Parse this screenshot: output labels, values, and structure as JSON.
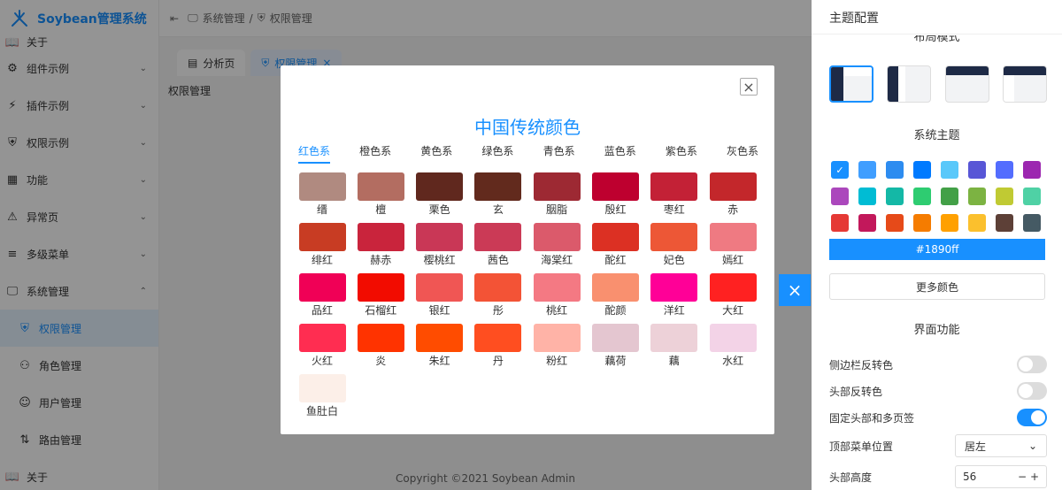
{
  "app": {
    "title": "Soybean管理系统"
  },
  "sidebar": {
    "items": [
      {
        "label": "关于",
        "icon": "book-icon",
        "clipped": true
      },
      {
        "label": "组件示例",
        "icon": "component-icon",
        "chevron": "⌄"
      },
      {
        "label": "插件示例",
        "icon": "plugin-icon",
        "chevron": "⌄"
      },
      {
        "label": "权限示例",
        "icon": "shield-icon",
        "chevron": "⌄"
      },
      {
        "label": "功能",
        "icon": "grid-icon",
        "chevron": "⌄"
      },
      {
        "label": "异常页",
        "icon": "error-page-icon",
        "chevron": "⌄"
      },
      {
        "label": "多级菜单",
        "icon": "menu-icon",
        "chevron": "⌄"
      },
      {
        "label": "系统管理",
        "icon": "monitor-icon",
        "chevron": "⌃"
      },
      {
        "label": "权限管理",
        "icon": "shield-icon",
        "active": true
      },
      {
        "label": "角色管理",
        "icon": "role-icon"
      },
      {
        "label": "用户管理",
        "icon": "user-icon"
      },
      {
        "label": "路由管理",
        "icon": "route-icon"
      },
      {
        "label": "关于",
        "icon": "book-icon"
      }
    ]
  },
  "header": {
    "breadcrumb": [
      "系统管理",
      "权限管理"
    ],
    "separator": "/"
  },
  "tabs": [
    {
      "label": "分析页",
      "icon": "dashboard-icon"
    },
    {
      "label": "权限管理",
      "icon": "shield-icon",
      "active": true,
      "close": "×"
    }
  ],
  "content": {
    "title": "权限管理"
  },
  "footer": {
    "text": "Copyright ©2021 Soybean Admin"
  },
  "modal": {
    "title": "中国传统颜色",
    "close": "×",
    "tabs": [
      "红色系",
      "橙色系",
      "黄色系",
      "绿色系",
      "青色系",
      "蓝色系",
      "紫色系",
      "灰色系"
    ],
    "active_tab": 0,
    "colors": [
      {
        "name": "缙",
        "color": "#b08a80"
      },
      {
        "name": "檀",
        "color": "#b36d61"
      },
      {
        "name": "栗色",
        "color": "#60281e"
      },
      {
        "name": "玄",
        "color": "#622a1d"
      },
      {
        "name": "胭脂",
        "color": "#9d2933"
      },
      {
        "name": "殷红",
        "color": "#be002f"
      },
      {
        "name": "枣红",
        "color": "#c32136"
      },
      {
        "name": "赤",
        "color": "#c3272b"
      },
      {
        "name": "绯红",
        "color": "#c83c23"
      },
      {
        "name": "赫赤",
        "color": "#c9243c"
      },
      {
        "name": "樱桃红",
        "color": "#c93756"
      },
      {
        "name": "茜色",
        "color": "#cb3a56"
      },
      {
        "name": "海棠红",
        "color": "#db5a6b"
      },
      {
        "name": "酡红",
        "color": "#dc3023"
      },
      {
        "name": "妃色",
        "color": "#ed5736"
      },
      {
        "name": "嫣红",
        "color": "#ef7a82"
      },
      {
        "name": "品红",
        "color": "#f00056"
      },
      {
        "name": "石榴红",
        "color": "#f20c00"
      },
      {
        "name": "银红",
        "color": "#f05654"
      },
      {
        "name": "彤",
        "color": "#f35336"
      },
      {
        "name": "桃红",
        "color": "#f47983"
      },
      {
        "name": "酡颜",
        "color": "#f9906f"
      },
      {
        "name": "洋红",
        "color": "#ff0097"
      },
      {
        "name": "大红",
        "color": "#ff2121"
      },
      {
        "name": "火红",
        "color": "#ff2d51"
      },
      {
        "name": "炎",
        "color": "#ff3300"
      },
      {
        "name": "朱红",
        "color": "#ff4c00"
      },
      {
        "name": "丹",
        "color": "#ff4e20"
      },
      {
        "name": "粉红",
        "color": "#ffb3a7"
      },
      {
        "name": "藕荷",
        "color": "#e4c6d0"
      },
      {
        "name": "藕",
        "color": "#edd1d8"
      },
      {
        "name": "水红",
        "color": "#f3d3e7"
      },
      {
        "name": "鱼肚白",
        "color": "#fcefe8"
      }
    ]
  },
  "drawer": {
    "title": "主题配置",
    "layout_section": "布局模式",
    "theme_section": "系统主题",
    "swatches": [
      {
        "color": "#1890ff",
        "selected": true,
        "mark": "✓"
      },
      {
        "color": "#409eff"
      },
      {
        "color": "#2d8cf0"
      },
      {
        "color": "#007aff"
      },
      {
        "color": "#5ac8fa"
      },
      {
        "color": "#5856d6"
      },
      {
        "color": "#536dfe"
      },
      {
        "color": "#9c27b0"
      },
      {
        "color": "#ab47bc"
      },
      {
        "color": "#00bcd4"
      },
      {
        "color": "#14b8a6"
      },
      {
        "color": "#2ecc71"
      },
      {
        "color": "#43a047"
      },
      {
        "color": "#7cb342"
      },
      {
        "color": "#c0ca33"
      },
      {
        "color": "#4fd1a5"
      },
      {
        "color": "#e53935"
      },
      {
        "color": "#c2185b"
      },
      {
        "color": "#e64a19"
      },
      {
        "color": "#f57c00"
      },
      {
        "color": "#ffa000"
      },
      {
        "color": "#fbc02d"
      },
      {
        "color": "#5d4037"
      },
      {
        "color": "#455a64"
      }
    ],
    "color_value": "#1890ff",
    "more_colors": "更多颜色",
    "ui_section": "界面功能",
    "toggles": [
      {
        "label": "侧边栏反转色",
        "on": false
      },
      {
        "label": "头部反转色",
        "on": false
      },
      {
        "label": "固定头部和多页签",
        "on": true
      }
    ],
    "menu_position": {
      "label": "顶部菜单位置",
      "value": "居左",
      "chevron": "⌄"
    },
    "header_height": {
      "label": "头部高度",
      "value": "56",
      "minus": "−",
      "plus": "+"
    },
    "close": "×"
  },
  "colors": {
    "accent": "#1890ff",
    "mask": "rgba(0,0,0,0.42)"
  }
}
